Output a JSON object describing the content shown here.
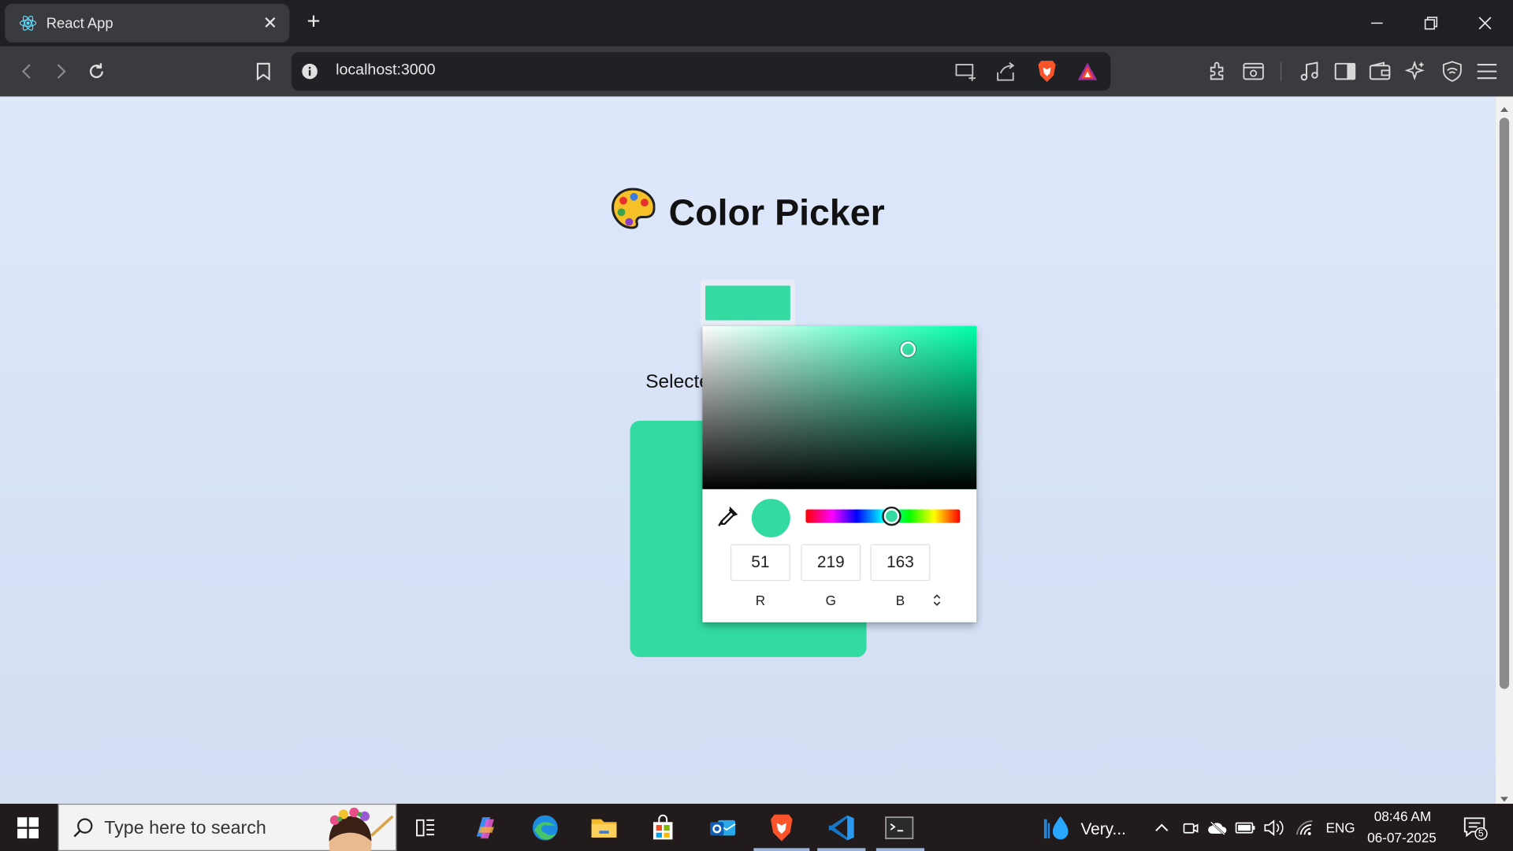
{
  "browser": {
    "tab_title": "React App",
    "url": "localhost:3000"
  },
  "page": {
    "heading_emoji": "🎨",
    "heading": "Color Picker",
    "selected_label": "Selecte",
    "selected_color": "#33dba3"
  },
  "picker": {
    "r": "51",
    "g": "219",
    "b": "163",
    "r_label": "R",
    "g_label": "G",
    "b_label": "B",
    "hue_fraction": 0.555,
    "saturation": 0.75,
    "value": 0.86
  },
  "taskbar": {
    "search_placeholder": "Type here to search",
    "weather": "Very...",
    "language": "ENG",
    "time": "08:46 AM",
    "date": "06-07-2025",
    "notifications": "5"
  }
}
